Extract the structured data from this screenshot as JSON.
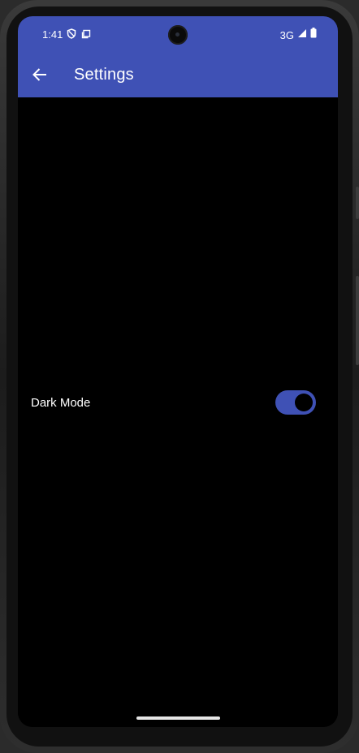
{
  "status_bar": {
    "time": "1:41",
    "left_icons": [
      "shield-icon",
      "screenshot-icon"
    ],
    "network": "3G",
    "right_icons": [
      "signal-icon",
      "battery-icon"
    ]
  },
  "app_bar": {
    "back_icon": "arrow-left-icon",
    "title": "Settings",
    "color": "#3f51b5"
  },
  "settings": {
    "dark_mode": {
      "label": "Dark Mode",
      "enabled": true
    }
  },
  "theme": {
    "background": "#000000",
    "accent": "#3f51b5"
  }
}
